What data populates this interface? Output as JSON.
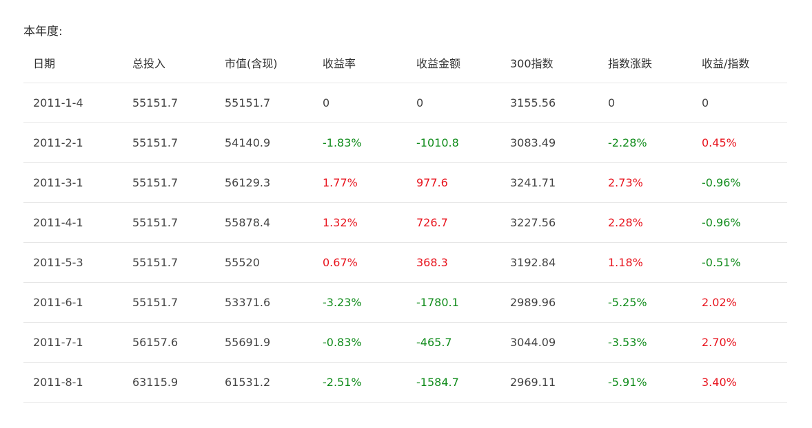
{
  "section": {
    "title": "本年度:"
  },
  "colors": {
    "positive": "#e8141e",
    "negative": "#118c1c",
    "text": "#444444",
    "divider": "#e6e6e6"
  },
  "table": {
    "headers": [
      "日期",
      "总投入",
      "市值(含现)",
      "收益率",
      "收益金额",
      "300指数",
      "指数涨跌",
      "收益/指数"
    ],
    "rows": [
      [
        "2011-1-4",
        "55151.7",
        "55151.7",
        "0",
        "0",
        "3155.56",
        "0",
        "0"
      ],
      [
        "2011-2-1",
        "55151.7",
        "54140.9",
        "-1.83%",
        "-1010.8",
        "3083.49",
        "-2.28%",
        "0.45%"
      ],
      [
        "2011-3-1",
        "55151.7",
        "56129.3",
        "1.77%",
        "977.6",
        "3241.71",
        "2.73%",
        "-0.96%"
      ],
      [
        "2011-4-1",
        "55151.7",
        "55878.4",
        "1.32%",
        "726.7",
        "3227.56",
        "2.28%",
        "-0.96%"
      ],
      [
        "2011-5-3",
        "55151.7",
        "55520",
        "0.67%",
        "368.3",
        "3192.84",
        "1.18%",
        "-0.51%"
      ],
      [
        "2011-6-1",
        "55151.7",
        "53371.6",
        "-3.23%",
        "-1780.1",
        "2989.96",
        "-5.25%",
        "2.02%"
      ],
      [
        "2011-7-1",
        "56157.6",
        "55691.9",
        "-0.83%",
        "-465.7",
        "3044.09",
        "-3.53%",
        "2.70%"
      ],
      [
        "2011-8-1",
        "63115.9",
        "61531.2",
        "-2.51%",
        "-1584.7",
        "2969.11",
        "-5.91%",
        "3.40%"
      ]
    ]
  }
}
